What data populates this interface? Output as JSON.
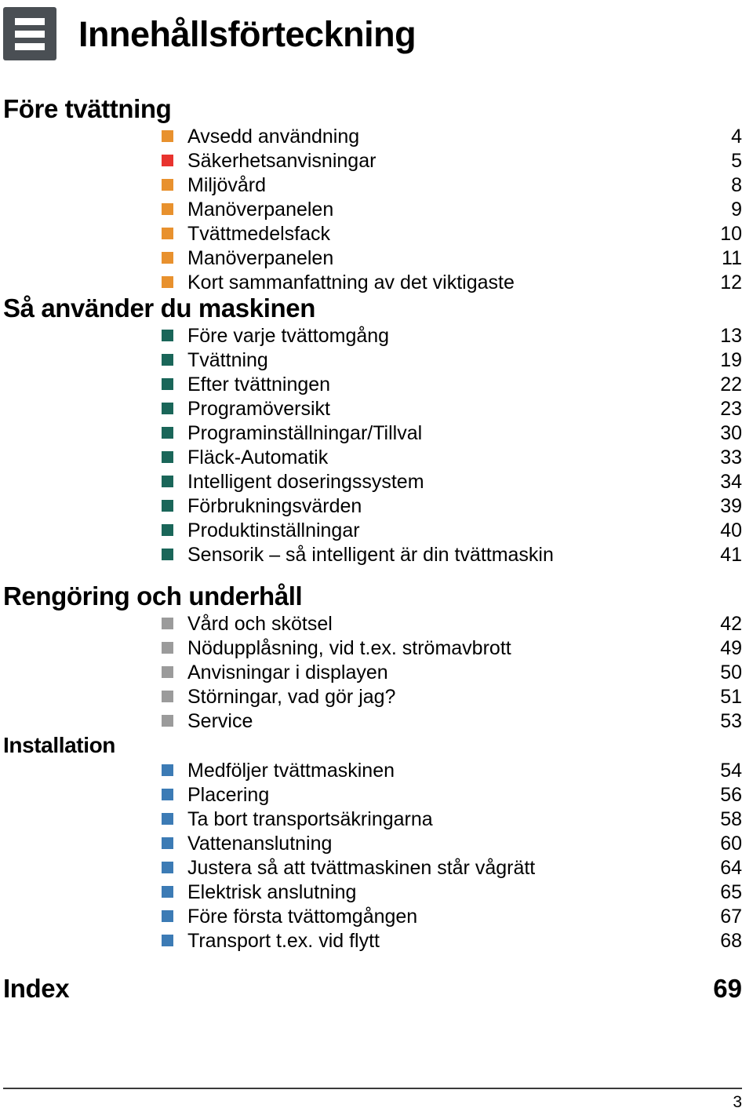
{
  "document": {
    "title": "Innehållsförteckning",
    "icon": "toc-list-icon",
    "icon_background": "#4a4f54",
    "footer_page_number": "3"
  },
  "bullet_colors": {
    "orange": "#e8912e",
    "red": "#e8332e",
    "teal": "#1a6659",
    "gray": "#9b9b9b",
    "blue": "#3c7bb5"
  },
  "sections": [
    {
      "heading": "Före tvättning",
      "heading_size": "large",
      "entries": [
        {
          "label": "Avsedd användning",
          "page": "4",
          "bullet": "orange"
        },
        {
          "label": "Säkerhetsanvisningar",
          "page": "5",
          "bullet": "red"
        },
        {
          "label": "Miljövård",
          "page": "8",
          "bullet": "orange"
        },
        {
          "label": "Manöverpanelen",
          "page": "9",
          "bullet": "orange"
        },
        {
          "label": "Tvättmedelsfack",
          "page": "10",
          "bullet": "orange"
        },
        {
          "label": "Manöverpanelen",
          "page": "11",
          "bullet": "orange"
        },
        {
          "label": "Kort sammanfattning av det viktigaste",
          "page": "12",
          "bullet": "orange"
        }
      ]
    },
    {
      "heading": "Så använder du maskinen",
      "heading_size": "large",
      "entries": [
        {
          "label": "Före varje tvättomgång",
          "page": "13",
          "bullet": "teal"
        },
        {
          "label": "Tvättning",
          "page": "19",
          "bullet": "teal"
        },
        {
          "label": "Efter tvättningen",
          "page": "22",
          "bullet": "teal"
        },
        {
          "label": "Programöversikt",
          "page": "23",
          "bullet": "teal"
        },
        {
          "label": "Programinställningar/Tillval",
          "page": "30",
          "bullet": "teal"
        },
        {
          "label": "Fläck-Automatik",
          "page": "33",
          "bullet": "teal"
        },
        {
          "label": "Intelligent doseringssystem",
          "page": "34",
          "bullet": "teal"
        },
        {
          "label": "Förbrukningsvärden",
          "page": "39",
          "bullet": "teal"
        },
        {
          "label": "Produktinställningar",
          "page": "40",
          "bullet": "teal"
        },
        {
          "label": "Sensorik – så intelligent är din tvättmaskin",
          "page": "41",
          "bullet": "teal"
        }
      ]
    },
    {
      "heading": "Rengöring och underhåll",
      "heading_size": "large",
      "entries": [
        {
          "label": "Vård och skötsel",
          "page": "42",
          "bullet": "gray"
        },
        {
          "label": "Nödupplåsning, vid t.ex. strömavbrott",
          "page": "49",
          "bullet": "gray"
        },
        {
          "label": "Anvisningar i displayen",
          "page": "50",
          "bullet": "gray"
        },
        {
          "label": "Störningar, vad gör jag?",
          "page": "51",
          "bullet": "gray"
        },
        {
          "label": "Service",
          "page": "53",
          "bullet": "gray"
        }
      ]
    },
    {
      "heading": "Installation",
      "heading_size": "small",
      "entries": [
        {
          "label": "Medföljer tvättmaskinen",
          "page": "54",
          "bullet": "blue"
        },
        {
          "label": "Placering",
          "page": "56",
          "bullet": "blue"
        },
        {
          "label": "Ta bort transportsäkringarna",
          "page": "58",
          "bullet": "blue"
        },
        {
          "label": "Vattenanslutning",
          "page": "60",
          "bullet": "blue"
        },
        {
          "label": "Justera så att tvättmaskinen står vågrätt",
          "page": "64",
          "bullet": "blue"
        },
        {
          "label": "Elektrisk anslutning",
          "page": "65",
          "bullet": "blue"
        },
        {
          "label": "Före första tvättomgången",
          "page": "67",
          "bullet": "blue"
        },
        {
          "label": "Transport t.ex. vid flytt",
          "page": "68",
          "bullet": "blue"
        }
      ]
    }
  ],
  "index": {
    "label": "Index",
    "page": "69"
  }
}
